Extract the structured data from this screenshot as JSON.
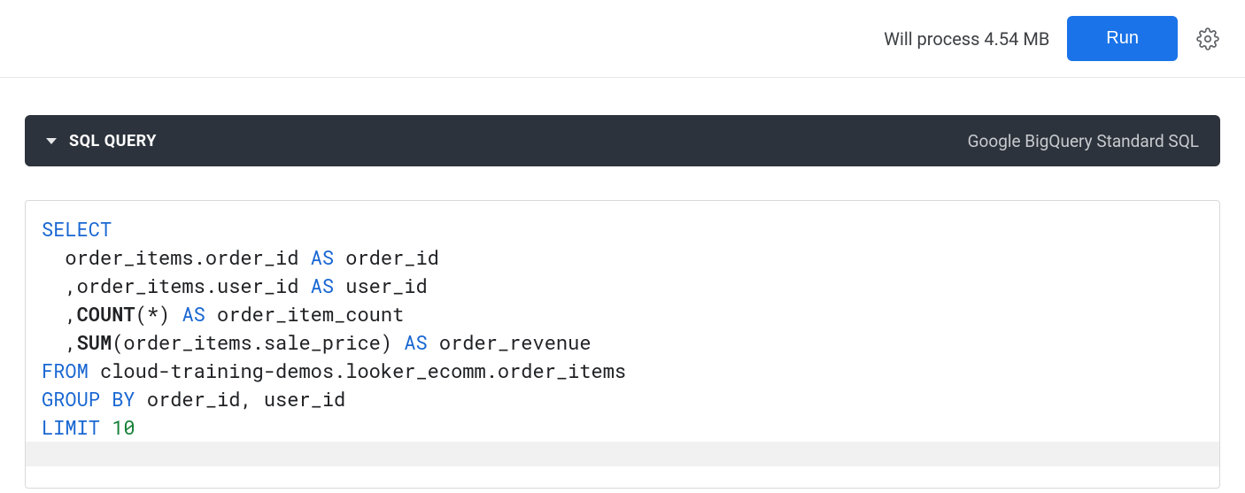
{
  "topbar": {
    "status_text": "Will process 4.54 MB",
    "run_label": "Run"
  },
  "section": {
    "title": "SQL QUERY",
    "dialect": "Google BigQuery Standard SQL"
  },
  "sql": {
    "tokens": [
      [
        {
          "t": "SELECT",
          "c": "kw"
        }
      ],
      [
        {
          "t": "  order_items.order_id ",
          "c": "ident"
        },
        {
          "t": "AS",
          "c": "kw"
        },
        {
          "t": " order_id",
          "c": "ident"
        }
      ],
      [
        {
          "t": "  ,order_items.user_id ",
          "c": "ident"
        },
        {
          "t": "AS",
          "c": "kw"
        },
        {
          "t": " user_id",
          "c": "ident"
        }
      ],
      [
        {
          "t": "  ,",
          "c": "ident"
        },
        {
          "t": "COUNT",
          "c": "fn"
        },
        {
          "t": "(*) ",
          "c": "ident"
        },
        {
          "t": "AS",
          "c": "kw"
        },
        {
          "t": " order_item_count",
          "c": "ident"
        }
      ],
      [
        {
          "t": "  ,",
          "c": "ident"
        },
        {
          "t": "SUM",
          "c": "fn"
        },
        {
          "t": "(order_items.sale_price) ",
          "c": "ident"
        },
        {
          "t": "AS",
          "c": "kw"
        },
        {
          "t": " order_revenue",
          "c": "ident"
        }
      ],
      [
        {
          "t": "FROM",
          "c": "kw"
        },
        {
          "t": " cloud-training-demos.looker_ecomm.order_items",
          "c": "ident"
        }
      ],
      [
        {
          "t": "GROUP BY",
          "c": "kw"
        },
        {
          "t": " order_id, user_id",
          "c": "ident"
        }
      ],
      [
        {
          "t": "LIMIT",
          "c": "kw"
        },
        {
          "t": " ",
          "c": "ident"
        },
        {
          "t": "10",
          "c": "nm"
        }
      ]
    ]
  }
}
